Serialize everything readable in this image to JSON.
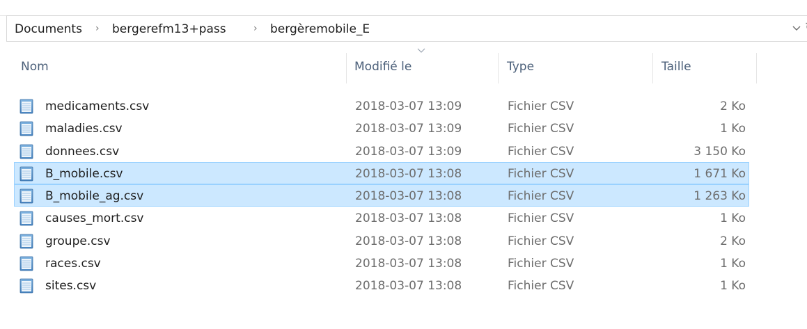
{
  "breadcrumb": {
    "items": [
      "Documents",
      "bergerefm13+pass",
      "bergèremobile_E"
    ],
    "separator": "›"
  },
  "columns": {
    "name": "Nom",
    "modified": "Modifié le",
    "type": "Type",
    "size": "Taille"
  },
  "files": [
    {
      "name": "medicaments.csv",
      "modified": "2018-03-07 13:09",
      "type": "Fichier CSV",
      "size": "2 Ko",
      "selected": false
    },
    {
      "name": "maladies.csv",
      "modified": "2018-03-07 13:09",
      "type": "Fichier CSV",
      "size": "1 Ko",
      "selected": false
    },
    {
      "name": "donnees.csv",
      "modified": "2018-03-07 13:09",
      "type": "Fichier CSV",
      "size": "3 150 Ko",
      "selected": false
    },
    {
      "name": "B_mobile.csv",
      "modified": "2018-03-07 13:08",
      "type": "Fichier CSV",
      "size": "1 671 Ko",
      "selected": true
    },
    {
      "name": "B_mobile_ag.csv",
      "modified": "2018-03-07 13:08",
      "type": "Fichier CSV",
      "size": "1 263 Ko",
      "selected": true
    },
    {
      "name": "causes_mort.csv",
      "modified": "2018-03-07 13:08",
      "type": "Fichier CSV",
      "size": "1 Ko",
      "selected": false
    },
    {
      "name": "groupe.csv",
      "modified": "2018-03-07 13:08",
      "type": "Fichier CSV",
      "size": "2 Ko",
      "selected": false
    },
    {
      "name": "races.csv",
      "modified": "2018-03-07 13:08",
      "type": "Fichier CSV",
      "size": "1 Ko",
      "selected": false
    },
    {
      "name": "sites.csv",
      "modified": "2018-03-07 13:08",
      "type": "Fichier CSV",
      "size": "1 Ko",
      "selected": false
    }
  ],
  "icons": {
    "file": "csv-file-icon",
    "dropdown": "chevron-down-icon",
    "refresh": "refresh-icon",
    "sort": "sort-caret-icon"
  },
  "colors": {
    "selection_bg": "#cce8ff",
    "selection_border": "#99d1ff",
    "header_text": "#4c607a"
  }
}
